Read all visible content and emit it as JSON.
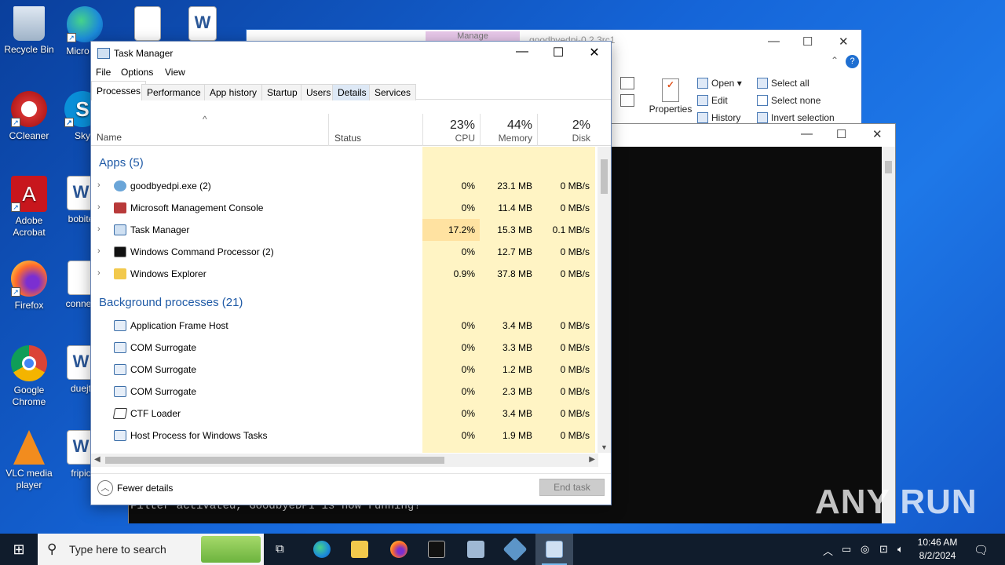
{
  "desktop": {
    "icons": [
      {
        "label": "Recycle Bin",
        "icon": "recycle-bin-icon"
      },
      {
        "label": "Micro Ed",
        "icon": "edge-icon"
      },
      {
        "label": "CCleaner",
        "icon": "ccleaner-icon"
      },
      {
        "label": "Sky",
        "icon": "skype-icon"
      },
      {
        "label": "Adobe Acrobat",
        "icon": "acrobat-icon"
      },
      {
        "label": "bobite",
        "icon": "word-doc-icon"
      },
      {
        "label": "Firefox",
        "icon": "firefox-icon"
      },
      {
        "label": "connec",
        "icon": "file-icon"
      },
      {
        "label": "Google Chrome",
        "icon": "chrome-icon"
      },
      {
        "label": "duejt",
        "icon": "word-doc-icon"
      },
      {
        "label": "VLC media player",
        "icon": "vlc-icon"
      },
      {
        "label": "fripic",
        "icon": "word-doc-icon"
      }
    ]
  },
  "explorer": {
    "title": "goodbyedpi-0.2.3rc1",
    "tab_label": "Manage",
    "ribbon": {
      "properties": "Properties",
      "open": "Open",
      "edit": "Edit",
      "history": "History",
      "select_all": "Select all",
      "select_none": "Select none",
      "invert_selection": "Invert selection"
    }
  },
  "console": {
    "last_line": "Filter activated, GoodbyeDPI is now running!"
  },
  "task_manager": {
    "title": "Task Manager",
    "menu": [
      "File",
      "Options",
      "View"
    ],
    "tabs": [
      "Processes",
      "Performance",
      "App history",
      "Startup",
      "Users",
      "Details",
      "Services"
    ],
    "active_tab": "Processes",
    "columns": {
      "name": "Name",
      "status": "Status",
      "cpu": {
        "pct": "23%",
        "label": "CPU"
      },
      "memory": {
        "pct": "44%",
        "label": "Memory"
      },
      "disk": {
        "pct": "2%",
        "label": "Disk"
      }
    },
    "groups": {
      "apps": "Apps (5)",
      "background": "Background processes (21)"
    },
    "apps": [
      {
        "name": "goodbyedpi.exe (2)",
        "cpu": "0%",
        "memory": "23.1 MB",
        "disk": "0 MB/s"
      },
      {
        "name": "Microsoft Management Console",
        "cpu": "0%",
        "memory": "11.4 MB",
        "disk": "0 MB/s"
      },
      {
        "name": "Task Manager",
        "cpu": "17.2%",
        "memory": "15.3 MB",
        "disk": "0.1 MB/s"
      },
      {
        "name": "Windows Command Processor (2)",
        "cpu": "0%",
        "memory": "12.7 MB",
        "disk": "0 MB/s"
      },
      {
        "name": "Windows Explorer",
        "cpu": "0.9%",
        "memory": "37.8 MB",
        "disk": "0 MB/s"
      }
    ],
    "background": [
      {
        "name": "Application Frame Host",
        "cpu": "0%",
        "memory": "3.4 MB",
        "disk": "0 MB/s"
      },
      {
        "name": "COM Surrogate",
        "cpu": "0%",
        "memory": "3.3 MB",
        "disk": "0 MB/s"
      },
      {
        "name": "COM Surrogate",
        "cpu": "0%",
        "memory": "1.2 MB",
        "disk": "0 MB/s"
      },
      {
        "name": "COM Surrogate",
        "cpu": "0%",
        "memory": "2.3 MB",
        "disk": "0 MB/s"
      },
      {
        "name": "CTF Loader",
        "cpu": "0%",
        "memory": "3.4 MB",
        "disk": "0 MB/s"
      },
      {
        "name": "Host Process for Windows Tasks",
        "cpu": "0%",
        "memory": "1.9 MB",
        "disk": "0 MB/s"
      }
    ],
    "fewer_details": "Fewer details",
    "end_task": "End task"
  },
  "taskbar": {
    "search_placeholder": "Type here to search",
    "time": "10:46 AM",
    "date": "8/2/2024"
  },
  "watermark": "ANY RUN"
}
